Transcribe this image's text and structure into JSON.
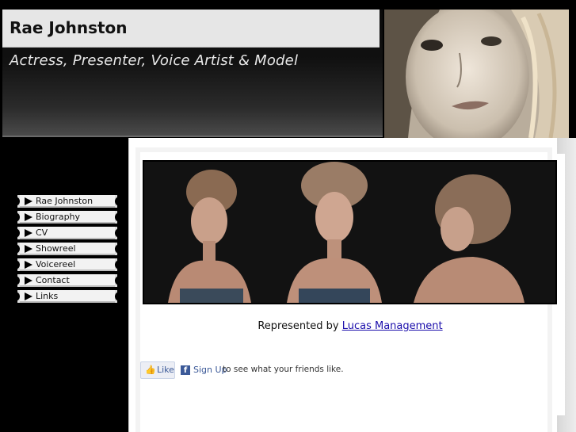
{
  "header": {
    "title": "Rae Johnston",
    "tagline": "Actress, Presenter, Voice Artist & Model"
  },
  "nav": {
    "items": [
      {
        "label": "Rae Johnston"
      },
      {
        "label": "Biography"
      },
      {
        "label": "CV"
      },
      {
        "label": "Showreel"
      },
      {
        "label": "Voicereel"
      },
      {
        "label": "Contact"
      },
      {
        "label": "Links"
      }
    ]
  },
  "main": {
    "represented_prefix": "Represented by",
    "agency_link": "Lucas Management"
  },
  "facebook": {
    "like_label": "Like",
    "signup_label": "Sign Up",
    "signup_text": "to see what your friends like."
  },
  "colors": {
    "background": "#000000",
    "link": "#1a0dab",
    "facebook": "#3b5998"
  }
}
